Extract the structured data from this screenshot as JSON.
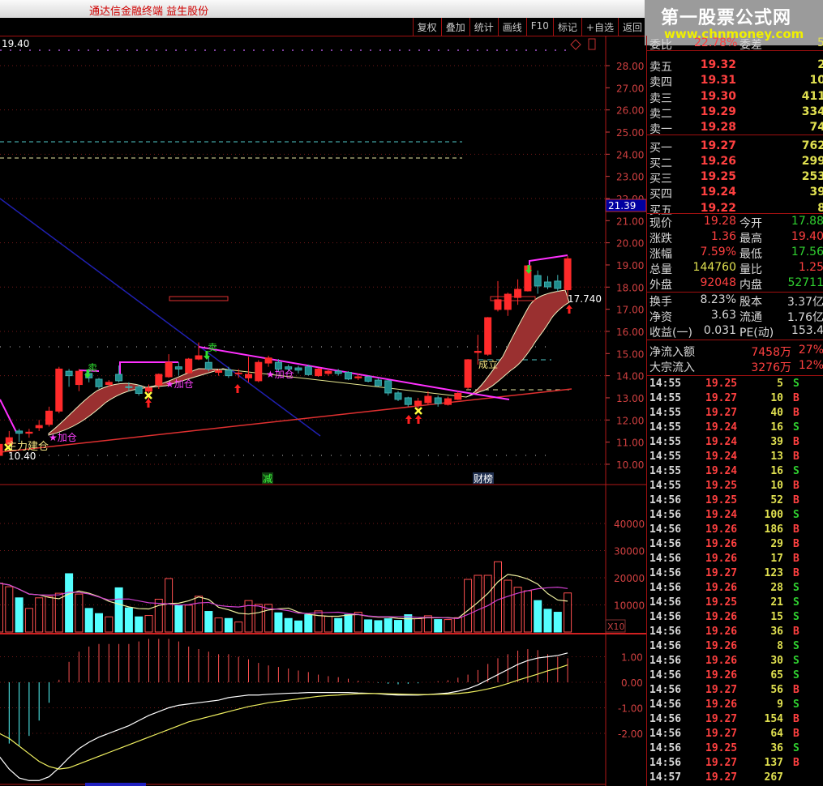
{
  "title": "通达信金融终端 益生股份",
  "toolbar": [
    "复权",
    "叠加",
    "统计",
    "画线",
    "F10",
    "标记",
    "+自选",
    "返回"
  ],
  "watermark": {
    "name": "第一股票公式网",
    "url": "www.chnmoney.com"
  },
  "chart_header": {
    "value": "19.40"
  },
  "current_price_tag": "21.39",
  "price_axis": [
    "28.00",
    "27.00",
    "26.00",
    "25.00",
    "24.00",
    "23.00",
    "22.00",
    "21.00",
    "20.00",
    "19.00",
    "18.00",
    "17.00",
    "16.00",
    "15.00",
    "14.00",
    "13.00",
    "12.00",
    "11.00",
    "10.00"
  ],
  "volume_axis": [
    "40000",
    "30000",
    "20000",
    "10000"
  ],
  "volume_unit": "X10",
  "macd_axis": [
    "1.00",
    "0.00",
    "-1.00",
    "-2.00"
  ],
  "annotations": {
    "build": "主力建仓",
    "add": "★加仓",
    "sell": "卖",
    "established": "成立",
    "low": "10.40",
    "support": "17.740",
    "reduce": "减",
    "caibang": "财榜"
  },
  "colors": {
    "up": "#ff2a2a",
    "down": "#1f8c8c",
    "down_vol": "#54ffff",
    "axis": "#d04040",
    "buy": "#ff4040",
    "sell": "#30d030",
    "qty": "#e0e050"
  },
  "quote": {
    "ratio": {
      "label": "委比",
      "value": "22.78%",
      "label2": "委差",
      "value2": "5"
    },
    "book": [
      {
        "label": "卖五",
        "price": "19.32",
        "qty": "2"
      },
      {
        "label": "卖四",
        "price": "19.31",
        "qty": "10"
      },
      {
        "label": "卖三",
        "price": "19.30",
        "qty": "411"
      },
      {
        "label": "卖二",
        "price": "19.29",
        "qty": "334"
      },
      {
        "label": "卖一",
        "price": "19.28",
        "qty": "74"
      },
      {
        "label": "买一",
        "price": "19.27",
        "qty": "762"
      },
      {
        "label": "买二",
        "price": "19.26",
        "qty": "299"
      },
      {
        "label": "买三",
        "price": "19.25",
        "qty": "253"
      },
      {
        "label": "买四",
        "price": "19.24",
        "qty": "39"
      },
      {
        "label": "买五",
        "price": "19.22",
        "qty": "8"
      }
    ],
    "stats": [
      {
        "l1": "现价",
        "v1": "19.28",
        "c1": "#ff4040",
        "l2": "今开",
        "v2": "17.88",
        "c2": "#30d030"
      },
      {
        "l1": "涨跌",
        "v1": "1.36",
        "c1": "#ff4040",
        "l2": "最高",
        "v2": "19.40",
        "c2": "#ff4040"
      },
      {
        "l1": "涨幅",
        "v1": "7.59%",
        "c1": "#ff4040",
        "l2": "最低",
        "v2": "17.56",
        "c2": "#30d030"
      },
      {
        "l1": "总量",
        "v1": "144760",
        "c1": "#e0e050",
        "l2": "量比",
        "v2": "1.25",
        "c2": "#ff4040"
      },
      {
        "l1": "外盘",
        "v1": "92048",
        "c1": "#ff4040",
        "l2": "内盘",
        "v2": "52711",
        "c2": "#30d030"
      }
    ],
    "finance": [
      {
        "l1": "换手",
        "v1": "8.23%",
        "l2": "股本",
        "v2": "3.37亿"
      },
      {
        "l1": "净资",
        "v1": "3.63",
        "l2": "流通",
        "v2": "1.76亿"
      },
      {
        "l1": "收益(一)",
        "v1": "0.031",
        "l2": "PE(动)",
        "v2": "153.4"
      }
    ],
    "flows": [
      {
        "label": "净流入额",
        "value": "7458万",
        "pct": "27%"
      },
      {
        "label": "大宗流入",
        "value": "3276万",
        "pct": "12%"
      }
    ],
    "ticks": [
      [
        "14:55",
        "19.25",
        "5",
        "S"
      ],
      [
        "14:55",
        "19.27",
        "10",
        "B"
      ],
      [
        "14:55",
        "19.27",
        "40",
        "B"
      ],
      [
        "14:55",
        "19.24",
        "16",
        "S"
      ],
      [
        "14:55",
        "19.24",
        "39",
        "B"
      ],
      [
        "14:55",
        "19.24",
        "13",
        "B"
      ],
      [
        "14:55",
        "19.24",
        "16",
        "S"
      ],
      [
        "14:55",
        "19.25",
        "10",
        "B"
      ],
      [
        "14:56",
        "19.25",
        "52",
        "B"
      ],
      [
        "14:56",
        "19.24",
        "100",
        "S"
      ],
      [
        "14:56",
        "19.26",
        "186",
        "B"
      ],
      [
        "14:56",
        "19.26",
        "29",
        "B"
      ],
      [
        "14:56",
        "19.26",
        "17",
        "B"
      ],
      [
        "14:56",
        "19.27",
        "123",
        "B"
      ],
      [
        "14:56",
        "19.26",
        "28",
        "S"
      ],
      [
        "14:56",
        "19.25",
        "21",
        "S"
      ],
      [
        "14:56",
        "19.26",
        "15",
        "S"
      ],
      [
        "14:56",
        "19.26",
        "36",
        "B"
      ],
      [
        "14:56",
        "19.26",
        "8",
        "S"
      ],
      [
        "14:56",
        "19.26",
        "30",
        "S"
      ],
      [
        "14:56",
        "19.26",
        "65",
        "S"
      ],
      [
        "14:56",
        "19.27",
        "56",
        "B"
      ],
      [
        "14:56",
        "19.26",
        "9",
        "S"
      ],
      [
        "14:56",
        "19.27",
        "154",
        "B"
      ],
      [
        "14:56",
        "19.27",
        "64",
        "B"
      ],
      [
        "14:56",
        "19.25",
        "36",
        "S"
      ],
      [
        "14:56",
        "19.27",
        "137",
        "B"
      ],
      [
        "14:57",
        "19.27",
        "267",
        ""
      ]
    ]
  },
  "chart_data": {
    "type": "candlestick",
    "ylim": [
      10,
      28
    ],
    "ohlc": [
      [
        10.4,
        10.9,
        11.0,
        10.4
      ],
      [
        10.9,
        11.2,
        11.5,
        10.6
      ],
      [
        11.5,
        11.4,
        11.6,
        11.0
      ],
      [
        11.4,
        11.45,
        11.6,
        11.2
      ],
      [
        11.65,
        11.75,
        12.0,
        11.5
      ],
      [
        11.8,
        12.4,
        12.6,
        11.7
      ],
      [
        12.4,
        14.3,
        14.4,
        12.3
      ],
      [
        14.2,
        14.0,
        14.3,
        13.5
      ],
      [
        13.6,
        14.2,
        14.3,
        13.3
      ],
      [
        14.1,
        13.9,
        14.3,
        13.7
      ],
      [
        13.84,
        13.5,
        13.9,
        13.4
      ],
      [
        13.6,
        13.7,
        13.8,
        13.5
      ],
      [
        14.06,
        13.77,
        14.46,
        13.7
      ],
      [
        13.5,
        13.47,
        13.7,
        13.3
      ],
      [
        13.5,
        13.2,
        13.6,
        13.1
      ],
      [
        13.3,
        13.45,
        13.6,
        12.9
      ],
      [
        13.58,
        14.06,
        14.1,
        13.4
      ],
      [
        13.95,
        14.6,
        14.97,
        13.9
      ],
      [
        14.4,
        14.3,
        14.6,
        14.0
      ],
      [
        14.13,
        14.75,
        14.8,
        14.1
      ],
      [
        14.75,
        14.9,
        15.5,
        14.7
      ],
      [
        14.6,
        14.3,
        14.9,
        14.2
      ],
      [
        14.15,
        14.22,
        14.3,
        14.0
      ],
      [
        14.25,
        14.0,
        14.4,
        13.9
      ],
      [
        14.1,
        14.12,
        14.3,
        13.9
      ],
      [
        13.9,
        14.06,
        14.85,
        13.7
      ],
      [
        13.77,
        14.6,
        14.7,
        13.7
      ],
      [
        14.57,
        14.8,
        14.9,
        14.4
      ],
      [
        14.6,
        14.3,
        14.75,
        14.2
      ],
      [
        14.4,
        14.3,
        14.5,
        14.2
      ],
      [
        14.35,
        14.25,
        14.45,
        14.1
      ],
      [
        14.4,
        14.05,
        14.5,
        14.0
      ],
      [
        14.0,
        14.3,
        14.35,
        13.95
      ],
      [
        14.1,
        14.2,
        14.3,
        14.0
      ],
      [
        14.2,
        14.1,
        14.3,
        14.0
      ],
      [
        14.15,
        13.85,
        14.2,
        13.8
      ],
      [
        13.9,
        13.95,
        14.1,
        13.8
      ],
      [
        13.95,
        13.75,
        14.0,
        13.7
      ],
      [
        13.8,
        13.55,
        13.9,
        13.5
      ],
      [
        13.77,
        13.22,
        13.8,
        13.1
      ],
      [
        13.22,
        12.93,
        13.3,
        12.85
      ],
      [
        13.0,
        12.7,
        13.05,
        12.6
      ],
      [
        12.67,
        12.85,
        13.0,
        12.5
      ],
      [
        12.78,
        13.07,
        13.3,
        12.7
      ],
      [
        13.0,
        12.74,
        13.1,
        12.6
      ],
      [
        12.7,
        12.96,
        13.05,
        12.65
      ],
      [
        12.93,
        13.2,
        13.3,
        12.9
      ],
      [
        13.47,
        14.72,
        14.75,
        13.4
      ],
      [
        15.05,
        15.1,
        15.85,
        14.5
      ],
      [
        14.97,
        16.62,
        16.65,
        14.9
      ],
      [
        16.99,
        17.43,
        18.27,
        16.9
      ],
      [
        16.99,
        17.68,
        17.75,
        16.7
      ],
      [
        17.53,
        17.9,
        18.35,
        17.2
      ],
      [
        17.83,
        18.96,
        19.0,
        17.8
      ],
      [
        18.52,
        18.05,
        18.75,
        17.7
      ],
      [
        18.23,
        18.01,
        18.5,
        17.9
      ],
      [
        18.27,
        17.94,
        18.55,
        17.8
      ],
      [
        17.88,
        19.28,
        19.4,
        17.56
      ]
    ],
    "volume": [
      18000,
      16700,
      12600,
      8700,
      12600,
      13100,
      14300,
      21500,
      14000,
      8700,
      6800,
      5600,
      16300,
      8900,
      5600,
      6100,
      12100,
      19700,
      9700,
      9900,
      13200,
      7600,
      5200,
      5000,
      3700,
      11600,
      10200,
      10200,
      7100,
      5000,
      4100,
      6400,
      7800,
      5800,
      5000,
      6400,
      7300,
      4500,
      4200,
      4900,
      4300,
      6400,
      4900,
      6000,
      4600,
      4600,
      5300,
      19400,
      20900,
      20900,
      25900,
      19100,
      16500,
      15200,
      11600,
      8400,
      7300,
      14400
    ],
    "volume_ylim": [
      0,
      50000
    ],
    "macd": {
      "dif": [
        -2.9,
        -3.4,
        -3.75,
        -3.85,
        -3.85,
        -3.7,
        -3.35,
        -2.95,
        -2.6,
        -2.35,
        -2.15,
        -2.0,
        -1.85,
        -1.7,
        -1.5,
        -1.3,
        -1.15,
        -1.0,
        -0.9,
        -0.85,
        -0.8,
        -0.75,
        -0.7,
        -0.6,
        -0.55,
        -0.5,
        -0.5,
        -0.47,
        -0.45,
        -0.43,
        -0.42,
        -0.4,
        -0.4,
        -0.4,
        -0.4,
        -0.4,
        -0.42,
        -0.43,
        -0.45,
        -0.48,
        -0.5,
        -0.5,
        -0.5,
        -0.48,
        -0.45,
        -0.42,
        -0.35,
        -0.25,
        -0.1,
        0.1,
        0.3,
        0.5,
        0.7,
        0.85,
        0.95,
        1.0,
        1.05,
        1.15
      ],
      "dea": [
        -2.0,
        -2.2,
        -2.5,
        -2.8,
        -3.1,
        -3.3,
        -3.4,
        -3.35,
        -3.2,
        -3.05,
        -2.9,
        -2.75,
        -2.6,
        -2.45,
        -2.3,
        -2.15,
        -2.0,
        -1.85,
        -1.7,
        -1.55,
        -1.45,
        -1.35,
        -1.25,
        -1.15,
        -1.05,
        -0.95,
        -0.88,
        -0.8,
        -0.75,
        -0.7,
        -0.65,
        -0.6,
        -0.55,
        -0.52,
        -0.5,
        -0.47,
        -0.45,
        -0.44,
        -0.44,
        -0.45,
        -0.46,
        -0.47,
        -0.48,
        -0.48,
        -0.47,
        -0.46,
        -0.44,
        -0.4,
        -0.34,
        -0.26,
        -0.17,
        -0.05,
        0.08,
        0.2,
        0.32,
        0.45,
        0.55,
        0.68
      ],
      "ylim": [
        -4,
        1.9
      ]
    }
  }
}
